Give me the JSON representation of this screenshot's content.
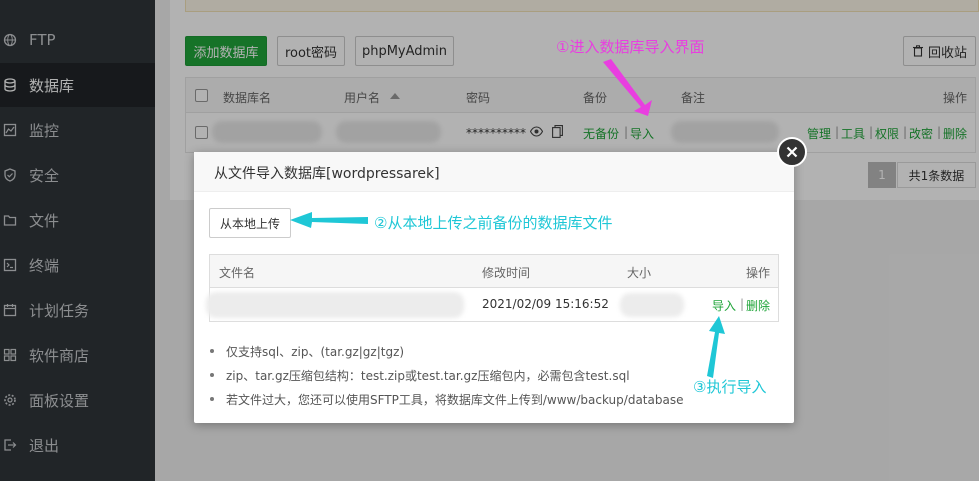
{
  "sidebar": {
    "items": [
      {
        "label": "FTP",
        "icon": "globe-icon"
      },
      {
        "label": "数据库",
        "icon": "database-icon"
      },
      {
        "label": "监控",
        "icon": "monitor-icon"
      },
      {
        "label": "安全",
        "icon": "shield-icon"
      },
      {
        "label": "文件",
        "icon": "folder-icon"
      },
      {
        "label": "终端",
        "icon": "terminal-icon"
      },
      {
        "label": "计划任务",
        "icon": "calendar-icon"
      },
      {
        "label": "软件商店",
        "icon": "apps-icon"
      },
      {
        "label": "面板设置",
        "icon": "gear-icon"
      },
      {
        "label": "退出",
        "icon": "logout-icon"
      }
    ]
  },
  "toolbar": {
    "add_db": "添加数据库",
    "root_pwd": "root密码",
    "phpmyadmin": "phpMyAdmin",
    "recycle": "回收站"
  },
  "db_table": {
    "headers": {
      "name": "数据库名",
      "user": "用户名",
      "password": "密码",
      "backup": "备份",
      "note": "备注",
      "ops": "操作"
    },
    "row": {
      "password": "**********",
      "no_backup": "无备份",
      "sep": "|",
      "import": "导入",
      "ops": [
        "管理",
        "工具",
        "权限",
        "改密",
        "删除"
      ]
    }
  },
  "pager": {
    "page": "1",
    "total": "共1条数据"
  },
  "dialog": {
    "title": "从文件导入数据库[wordpressarek]",
    "upload_label": "从本地上传",
    "file_table": {
      "headers": {
        "name": "文件名",
        "mtime": "修改时间",
        "size": "大小",
        "ops": "操作"
      },
      "row": {
        "mtime": "2021/02/09 15:16:52",
        "import": "导入",
        "sep": "|",
        "delete": "删除"
      }
    },
    "notes": [
      "仅支持sql、zip、(tar.gz|gz|tgz)",
      "zip、tar.gz压缩包结构：test.zip或test.tar.gz压缩包内，必需包含test.sql",
      "若文件过大，您还可以使用SFTP工具，将数据库文件上传到/www/backup/database"
    ]
  },
  "annotations": {
    "step1": "①进入数据库导入界面",
    "step2": "②从本地上传之前备份的数据库文件",
    "step3": "③执行导入"
  },
  "colors": {
    "accent": "#20a53a",
    "magenta": "#e93ee0",
    "cyan": "#1fc7d6",
    "sidebar": "#30353a"
  }
}
